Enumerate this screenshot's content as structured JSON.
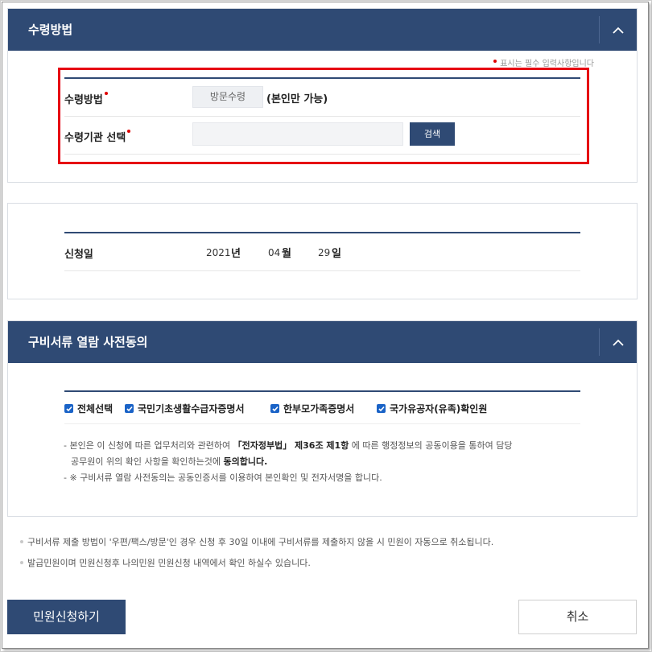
{
  "receive_section": {
    "title": "수령방법",
    "required_note": "표시는 필수 입력사항입니다",
    "method_label": "수령방법",
    "method_value": "방문수령",
    "method_note": "(본인만 가능)",
    "agency_label": "수령기관 선택",
    "agency_value": "",
    "search_label": "검색"
  },
  "application_date": {
    "label": "신청일",
    "year": "2021",
    "year_unit": "년",
    "month": "04",
    "month_unit": "월",
    "day": "29",
    "day_unit": "일"
  },
  "consent_section": {
    "title": "구비서류 열람 사전동의",
    "checkboxes": [
      {
        "label": "전체선택",
        "checked": true
      },
      {
        "label": "국민기초생활수급자증명서",
        "checked": true
      },
      {
        "label": "한부모가족증명서",
        "checked": true
      },
      {
        "label": "국가유공자(유족)확인원",
        "checked": true
      }
    ],
    "notice1_a": "- 본인은 이 신청에 따른 업무처리와 관련하여 ",
    "notice1_law": "「전자정부법」 제36조 제1항",
    "notice1_b": " 에 따른 행정정보의 공동이용을 통하여 담당",
    "notice1_c": "공무원이 위의 확인 사항을 확인하는것에 ",
    "notice1_agree": "동의합니다.",
    "notice2": "- ※ 구비서류 열람 사전동의는 공동인증서를 이용하여 본인확인 및 전자서명을 합니다."
  },
  "footnotes": [
    "구비서류 제출 방법이 '우편/팩스/방문'인 경우 신청 후 30일 이내에 구비서류를 제출하지 않을 시 민원이 자동으로 취소됩니다.",
    "발급민원이며 민원신청후 나의민원 민원신청 내역에서 확인 하실수 있습니다."
  ],
  "actions": {
    "submit_label": "민원신청하기",
    "cancel_label": "취소"
  },
  "colors": {
    "header_navy": "#2f4a74",
    "checkbox_blue": "#1a63c7",
    "required_red": "#e00000",
    "highlight_red": "#e60012"
  }
}
